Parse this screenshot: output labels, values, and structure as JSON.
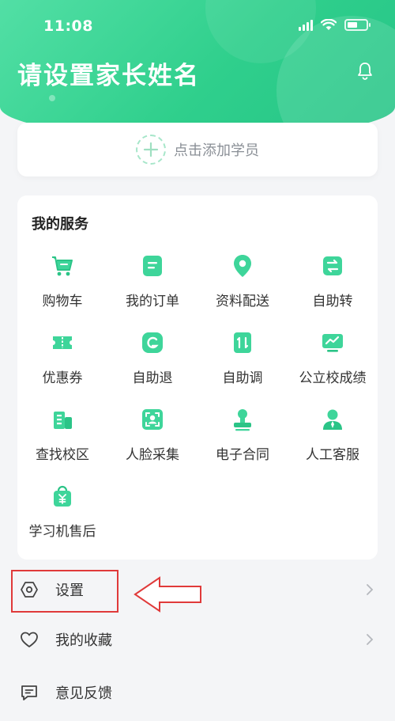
{
  "status_bar": {
    "time": "11:08"
  },
  "header": {
    "parent_name": "请设置家长姓名"
  },
  "add_student": {
    "label": "点击添加学员"
  },
  "services": {
    "title": "我的服务",
    "items": [
      {
        "label": "购物车",
        "icon": "cart-icon"
      },
      {
        "label": "我的订单",
        "icon": "order-icon"
      },
      {
        "label": "资料配送",
        "icon": "location-pin-icon"
      },
      {
        "label": "自助转",
        "icon": "transfer-icon"
      },
      {
        "label": "优惠券",
        "icon": "coupon-icon"
      },
      {
        "label": "自助退",
        "icon": "refund-icon"
      },
      {
        "label": "自助调",
        "icon": "adjust-icon"
      },
      {
        "label": "公立校成绩",
        "icon": "grade-monitor-icon"
      },
      {
        "label": "查找校区",
        "icon": "building-icon"
      },
      {
        "label": "人脸采集",
        "icon": "face-scan-icon"
      },
      {
        "label": "电子合同",
        "icon": "stamp-icon"
      },
      {
        "label": "人工客服",
        "icon": "agent-icon"
      },
      {
        "label": "学习机售后",
        "icon": "after-sales-bag-icon"
      }
    ]
  },
  "menu": {
    "settings": "设置",
    "favorites": "我的收藏",
    "feedback": "意见反馈"
  },
  "colors": {
    "brand_green": "#2fcf8c",
    "highlight_red": "#e03a3a"
  }
}
